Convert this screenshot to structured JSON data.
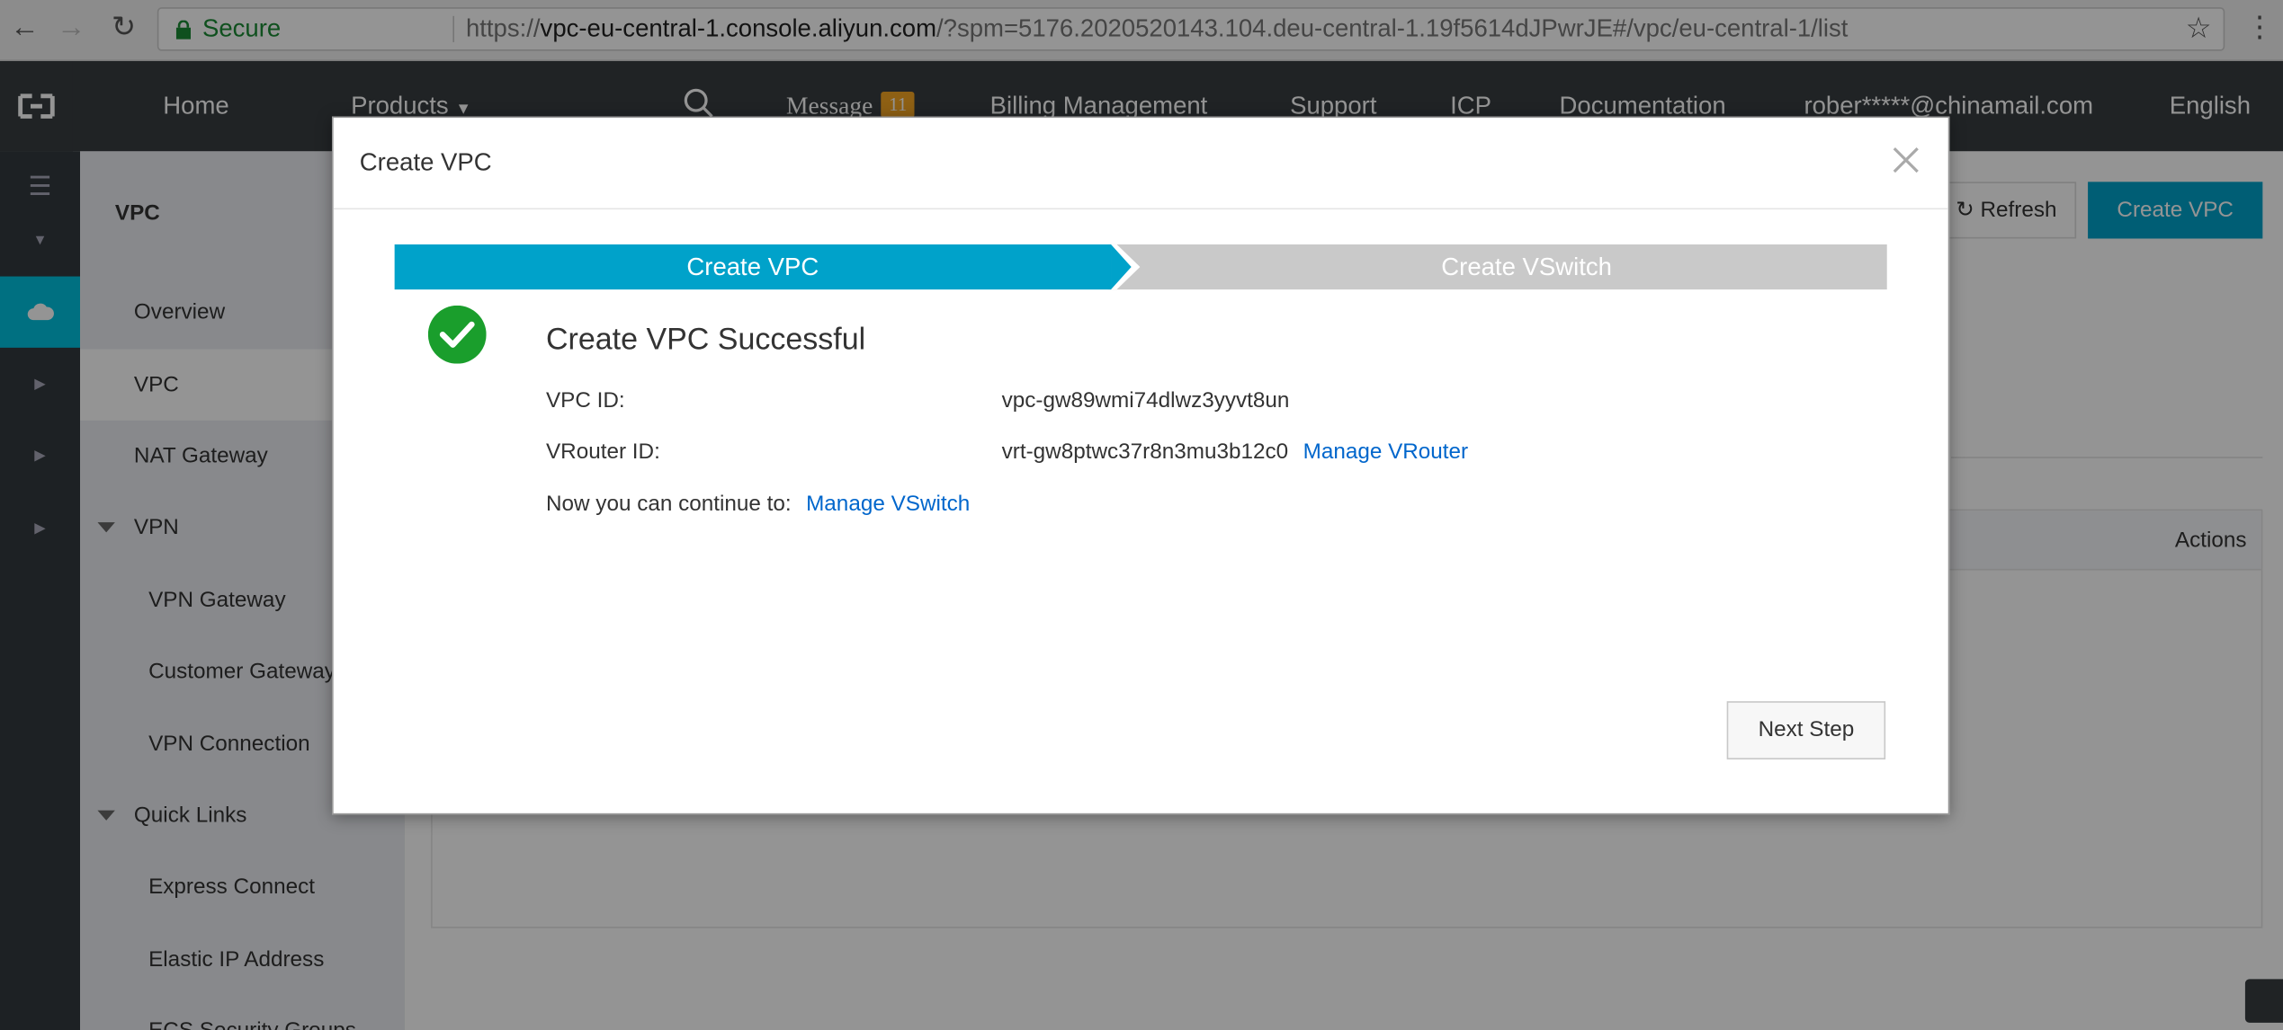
{
  "browser": {
    "secure_label": "Secure",
    "url_prefix": "https://",
    "url_host": "vpc-eu-central-1.console.aliyun.com",
    "url_rest": "/?spm=5176.2020520143.104.deu-central-1.19f5614dJPwrJE#/vpc/eu-central-1/list"
  },
  "topnav": {
    "home": "Home",
    "products": "Products",
    "message": "Message",
    "message_count": "11",
    "billing": "Billing Management",
    "support": "Support",
    "icp": "ICP",
    "documentation": "Documentation",
    "account": "rober*****@chinamail.com",
    "language": "English"
  },
  "sidebar": {
    "title": "VPC",
    "items": [
      {
        "label": "Overview"
      },
      {
        "label": "VPC"
      },
      {
        "label": "NAT Gateway"
      },
      {
        "label": "VPN"
      },
      {
        "label": "VPN Gateway"
      },
      {
        "label": "Customer Gateway"
      },
      {
        "label": "VPN Connection"
      },
      {
        "label": "Quick Links"
      },
      {
        "label": "Express Connect"
      },
      {
        "label": "Elastic IP Address"
      },
      {
        "label": "ECS Security Groups"
      }
    ]
  },
  "main": {
    "refresh_label": "Refresh",
    "create_vpc_label": "Create VPC",
    "actions_header": "Actions"
  },
  "modal": {
    "title": "Create VPC",
    "steps": [
      "Create VPC",
      "Create VSwitch"
    ],
    "success_title": "Create VPC Successful",
    "vpc_id_label": "VPC ID:",
    "vpc_id": "vpc-gw89wmi74dlwz3yyvt8un",
    "vrouter_id_label": "VRouter ID:",
    "vrouter_id": "vrt-gw8ptwc37r8n3mu3b12c0",
    "manage_vrouter": "Manage VRouter",
    "continue_label": "Now you can continue to:",
    "manage_vswitch": "Manage VSwitch",
    "next_step": "Next Step"
  },
  "colors": {
    "accent": "#00a2ca",
    "success": "#1a9e2c",
    "link": "#0066cc",
    "topnav_bg": "#373d41"
  }
}
